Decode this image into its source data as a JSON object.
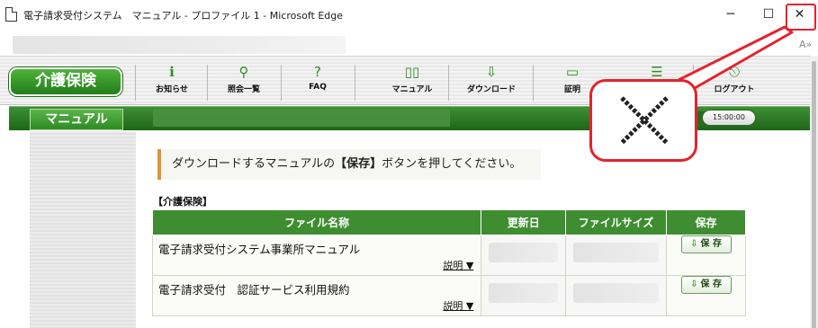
{
  "window": {
    "title": "電子請求受付システム　マニュアル - プロファイル 1 - Microsoft Edge",
    "minimize_glyph": "─",
    "maximize_glyph": "☐",
    "close_glyph": "✕"
  },
  "toolbar": {
    "read_aloud_glyph": "A»"
  },
  "header": {
    "logo_label": "介護保険",
    "nav": [
      {
        "label": "お知らせ",
        "icon": "info-icon",
        "glyph": "ℹ"
      },
      {
        "label": "照会一覧",
        "icon": "search-icon",
        "glyph": "⚲"
      },
      {
        "label": "FAQ",
        "icon": "faq-icon",
        "glyph": "?"
      },
      {
        "label": "マニュアル",
        "icon": "book-icon",
        "glyph": "▯▯"
      },
      {
        "label": "ダウンロード",
        "icon": "download-icon",
        "glyph": "⇩"
      },
      {
        "label": "証明",
        "icon": "certificate-icon",
        "glyph": "▭"
      },
      {
        "label": "",
        "icon": "list-icon",
        "glyph": "☰"
      },
      {
        "label": "ログアウト",
        "icon": "logout-icon",
        "glyph": "⎋"
      }
    ]
  },
  "page": {
    "tab_title": "マニュアル",
    "time": "15:00:00",
    "notice_before": "ダウンロードするマニュアルの",
    "notice_bold": "【保存】",
    "notice_after": "ボタンを押してください。",
    "section_label": "【介護保険】"
  },
  "table": {
    "headers": [
      "ファイル名称",
      "更新日",
      "ファイルサイズ",
      "保存"
    ],
    "rows": [
      {
        "name": "電子請求受付システム事業所マニュアル",
        "desc_label": "説明 ▼",
        "save_label": "保 存"
      },
      {
        "name": "電子請求受付　認証サービス利用規約",
        "desc_label": "説明 ▼",
        "save_label": "保 存"
      }
    ]
  },
  "callout": {
    "icon": "close-icon"
  },
  "colors": {
    "accent_green": "#3f8d31",
    "highlight_red": "#e2232d",
    "notice_bar": "#d9963a"
  }
}
